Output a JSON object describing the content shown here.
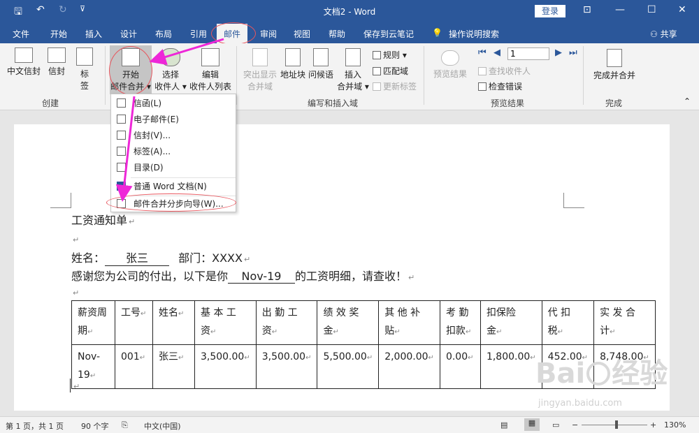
{
  "window": {
    "title": "文档2 - Word",
    "login_label": "登录"
  },
  "qat": {
    "save": "🖫",
    "undo": "↶",
    "redo": "↻",
    "customize": "⊽"
  },
  "window_controls": {
    "ribbon_options": "⊡",
    "minimize": "—",
    "maximize": "☐",
    "close": "✕"
  },
  "tabs": [
    {
      "label": "文件"
    },
    {
      "label": "开始"
    },
    {
      "label": "插入"
    },
    {
      "label": "设计"
    },
    {
      "label": "布局"
    },
    {
      "label": "引用"
    },
    {
      "label": "邮件"
    },
    {
      "label": "审阅"
    },
    {
      "label": "视图"
    },
    {
      "label": "帮助"
    },
    {
      "label": "保存到云笔记"
    }
  ],
  "tell_me": "操作说明搜索",
  "share": "共享",
  "ribbon": {
    "create": {
      "label": "创建",
      "chinese_envelope": "中文信封",
      "envelope": "信封",
      "labels_line1": "标",
      "labels_line2": "签"
    },
    "start": {
      "start_line1": "开始",
      "start_line2": "邮件合并 ▾",
      "select_line1": "选择",
      "select_line2": "收件人 ▾",
      "edit_line1": "编辑",
      "edit_line2": "收件人列表"
    },
    "write": {
      "label": "编写和插入域",
      "highlight_line1": "突出显示",
      "highlight_line2": "合并域",
      "address_block": "地址块",
      "greeting_line": "问候语",
      "insert_field_line1": "插入",
      "insert_field_line2": "合并域 ▾",
      "rules": "规则 ▾",
      "match_fields": "匹配域",
      "update_labels": "更新标签"
    },
    "preview": {
      "label": "预览结果",
      "preview_results": "预览结果",
      "record": "1",
      "find_recipient": "查找收件人",
      "check_errors": "检查错误"
    },
    "finish": {
      "label": "完成",
      "finish_merge": "完成并合并"
    }
  },
  "dropdown": {
    "items": [
      {
        "label": "信函(L)"
      },
      {
        "label": "电子邮件(E)"
      },
      {
        "label": "信封(V)..."
      },
      {
        "label": "标签(A)..."
      },
      {
        "label": "目录(D)"
      },
      {
        "label": "普通 Word 文档(N)"
      },
      {
        "label": "邮件合并分步向导(W)..."
      }
    ]
  },
  "document": {
    "title": "工资通知单",
    "name_label": "姓名：",
    "name_value": "张三",
    "dept_label": "部门：XXXX",
    "thanks_prefix": "感谢您为公司的付出，以下是你",
    "period_value": "Nov-19",
    "thanks_suffix": "的工资明细，请查收！",
    "table": {
      "headers": [
        [
          "薪资周",
          "期"
        ],
        [
          "工号",
          ""
        ],
        [
          "姓名",
          ""
        ],
        [
          "基 本 工",
          "资"
        ],
        [
          "出 勤 工",
          "资"
        ],
        [
          "绩 效 奖",
          "金"
        ],
        [
          "其 他 补",
          "贴"
        ],
        [
          "考 勤",
          "扣款"
        ],
        [
          "扣保险",
          "金"
        ],
        [
          "代 扣",
          "税"
        ],
        [
          "实 发 合",
          "计"
        ]
      ],
      "row": [
        [
          "Nov-",
          "19"
        ],
        [
          "001",
          ""
        ],
        [
          "张三",
          ""
        ],
        [
          "3,500.00",
          ""
        ],
        [
          "3,500.00",
          ""
        ],
        [
          "5,500.00",
          ""
        ],
        [
          "2,000.00",
          ""
        ],
        [
          "0.00",
          ""
        ],
        [
          "1,800.00",
          ""
        ],
        [
          "452.00",
          ""
        ],
        [
          "8,748.00",
          ""
        ]
      ]
    }
  },
  "status": {
    "page": "第 1 页，共 1 页",
    "words": "90 个字",
    "language": "中文(中国)",
    "zoom": "130%"
  },
  "watermark": {
    "brand": "Bai",
    "brand2": "经验",
    "url": "jingyan.baidu.com"
  },
  "colors": {
    "title_bar": "#2b579a",
    "ribbon": "#f3f3f3",
    "annotation": "#e8565e",
    "arrow": "#ee27d8"
  }
}
